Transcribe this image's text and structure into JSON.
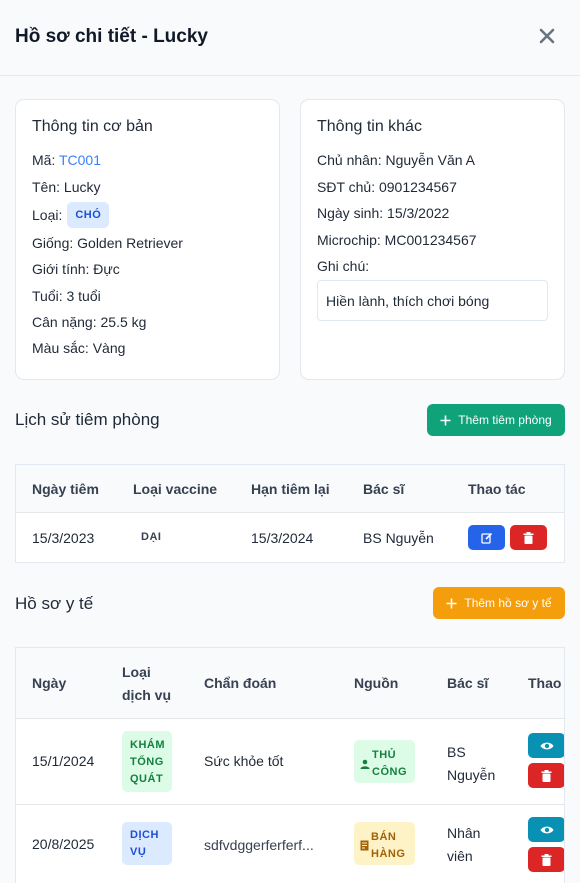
{
  "header": {
    "title": "Hồ sơ chi tiết - Lucky"
  },
  "basic": {
    "title": "Thông tin cơ bản",
    "code_label": "Mã:",
    "code_value": "TC001",
    "name": "Tên: Lucky",
    "type_label": "Loại:",
    "type_value": "CHÓ",
    "breed": "Giống: Golden Retriever",
    "gender": "Giới tính: Đực",
    "age": "Tuổi: 3 tuổi",
    "weight": "Cân nặng: 25.5 kg",
    "color": "Màu sắc: Vàng"
  },
  "other": {
    "title": "Thông tin khác",
    "owner": "Chủ nhân: Nguyễn Văn A",
    "phone": "SĐT chủ: 0901234567",
    "birthday": "Ngày sinh: 15/3/2022",
    "microchip": "Microchip: MC001234567",
    "note_label": "Ghi chú:",
    "note_value": "Hiền lành, thích chơi bóng"
  },
  "vaccination": {
    "title": "Lịch sử tiêm phòng",
    "add_label": "Thêm tiêm phòng",
    "columns": [
      "Ngày tiêm",
      "Loại vaccine",
      "Hạn tiêm lại",
      "Bác sĩ",
      "Thao tác"
    ],
    "rows": [
      {
        "date": "15/3/2023",
        "vaccine": "DẠI",
        "due": "15/3/2024",
        "doctor": "BS Nguyễn"
      }
    ]
  },
  "medical": {
    "title": "Hồ sơ y tế",
    "add_label": "Thêm hồ sơ y tế",
    "columns": {
      "date": "Ngày",
      "service_1": "Loại",
      "service_2": "dịch vụ",
      "diagnosis": "Chẩn đoán",
      "source": "Nguồn",
      "doctor": "Bác sĩ",
      "actions": "Thao tác"
    },
    "rows": [
      {
        "date": "15/1/2024",
        "service": [
          "KHÁM",
          "TỔNG",
          "QUÁT"
        ],
        "diagnosis": "Sức khỏe tốt",
        "source": [
          "THỦ",
          "CÔNG"
        ],
        "doctor": [
          "BS",
          "Nguyễn"
        ]
      },
      {
        "date": "20/8/2025",
        "service": [
          "DỊCH",
          "VỤ"
        ],
        "diagnosis": "sdfvdggerferferf...",
        "source": [
          "BÁN",
          "HÀNG"
        ],
        "doctor": [
          "Nhân",
          "viên"
        ]
      }
    ]
  },
  "colors": {
    "accent_green": "#10a37a",
    "accent_amber": "#f59e0b",
    "edit_blue": "#2563eb",
    "delete_red": "#dc2626",
    "view_cyan": "#0891b2"
  },
  "icons": [
    "close-icon",
    "plus-icon",
    "edit-icon",
    "trash-icon",
    "eye-icon",
    "user-icon",
    "receipt-icon"
  ]
}
